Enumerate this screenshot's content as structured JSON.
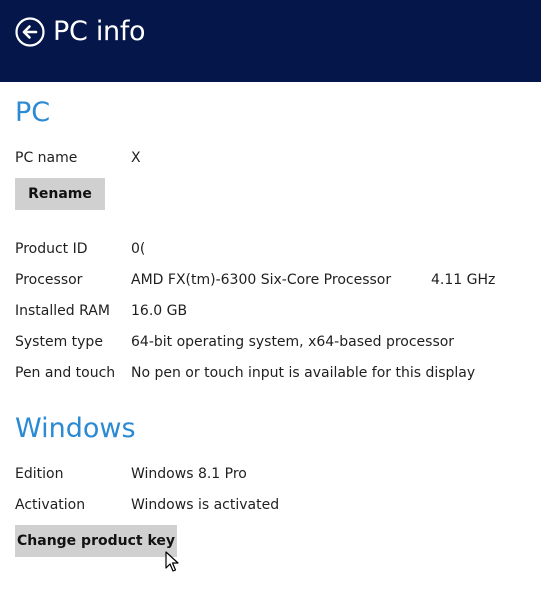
{
  "header": {
    "title": "PC info",
    "background": "#04164a"
  },
  "icons": {
    "back": "back-arrow-circle-icon",
    "cursor": "mouse-pointer-icon"
  },
  "pc_section": {
    "title": "PC",
    "pc_name": {
      "label": "PC name",
      "value": "X"
    },
    "rename_button": "Rename",
    "product_id": {
      "label": "Product ID",
      "value": "0("
    },
    "processor": {
      "label": "Processor",
      "value": "AMD FX(tm)-6300 Six-Core Processor",
      "speed": "4.11 GHz"
    },
    "installed_ram": {
      "label": "Installed RAM",
      "value": "16.0 GB"
    },
    "system_type": {
      "label": "System type",
      "value": "64-bit operating system, x64-based processor"
    },
    "pen_and_touch": {
      "label": "Pen and touch",
      "value": "No pen or touch input is available for this display"
    }
  },
  "windows_section": {
    "title": "Windows",
    "edition": {
      "label": "Edition",
      "value": "Windows 8.1 Pro"
    },
    "activation": {
      "label": "Activation",
      "value": "Windows is activated"
    },
    "change_key_button": "Change product key"
  },
  "colors": {
    "accent": "#2a8ad3",
    "button_bg": "#d0d0d0"
  }
}
